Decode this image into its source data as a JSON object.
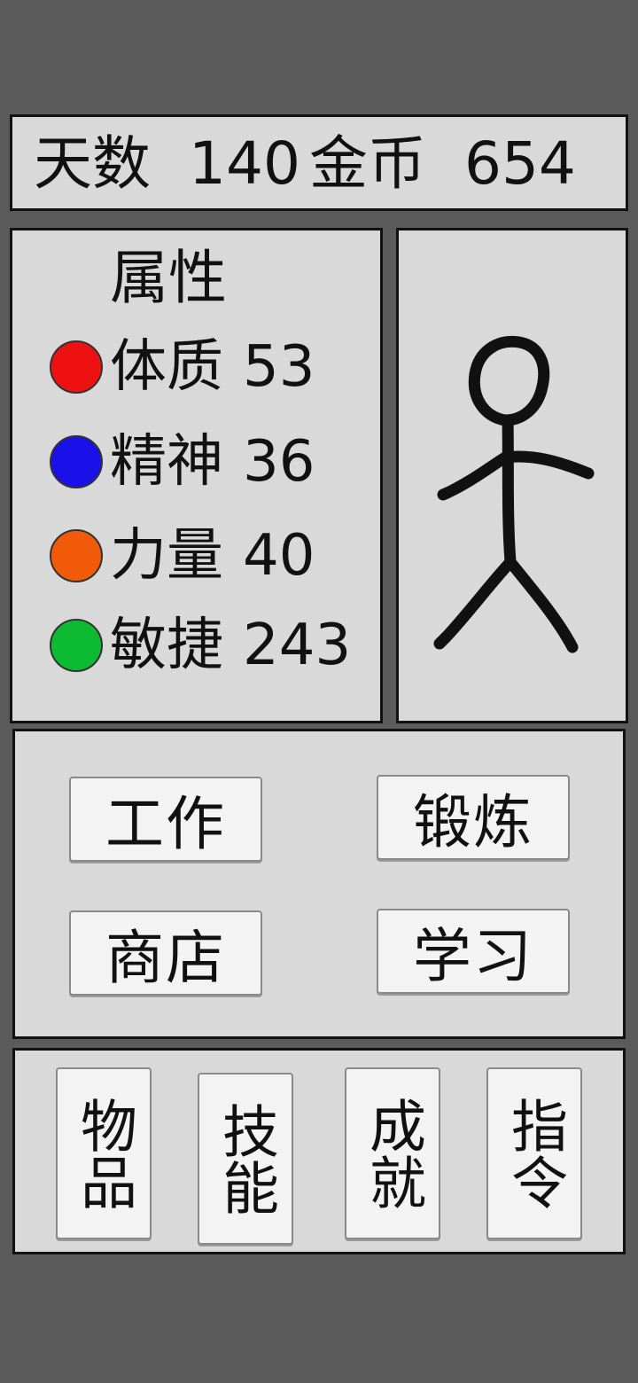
{
  "top_bar": {
    "days_label": "天数",
    "days_value": "140",
    "gold_label": "金币",
    "gold_value": "654"
  },
  "attributes": {
    "title": "属性",
    "stats": [
      {
        "label": "体质",
        "value": "53",
        "color": "#ee1111"
      },
      {
        "label": "精神",
        "value": "36",
        "color": "#1a10e8"
      },
      {
        "label": "力量",
        "value": "40",
        "color": "#f05a08"
      },
      {
        "label": "敏捷",
        "value": "243",
        "color": "#0dbb33"
      }
    ]
  },
  "character": {
    "icon": "stick-figure"
  },
  "actions": {
    "work": "工作",
    "exercise": "锻炼",
    "shop": "商店",
    "study": "学习"
  },
  "nav": {
    "items": "物品",
    "skills": "技能",
    "achievements": "成就",
    "commands": "指令"
  }
}
